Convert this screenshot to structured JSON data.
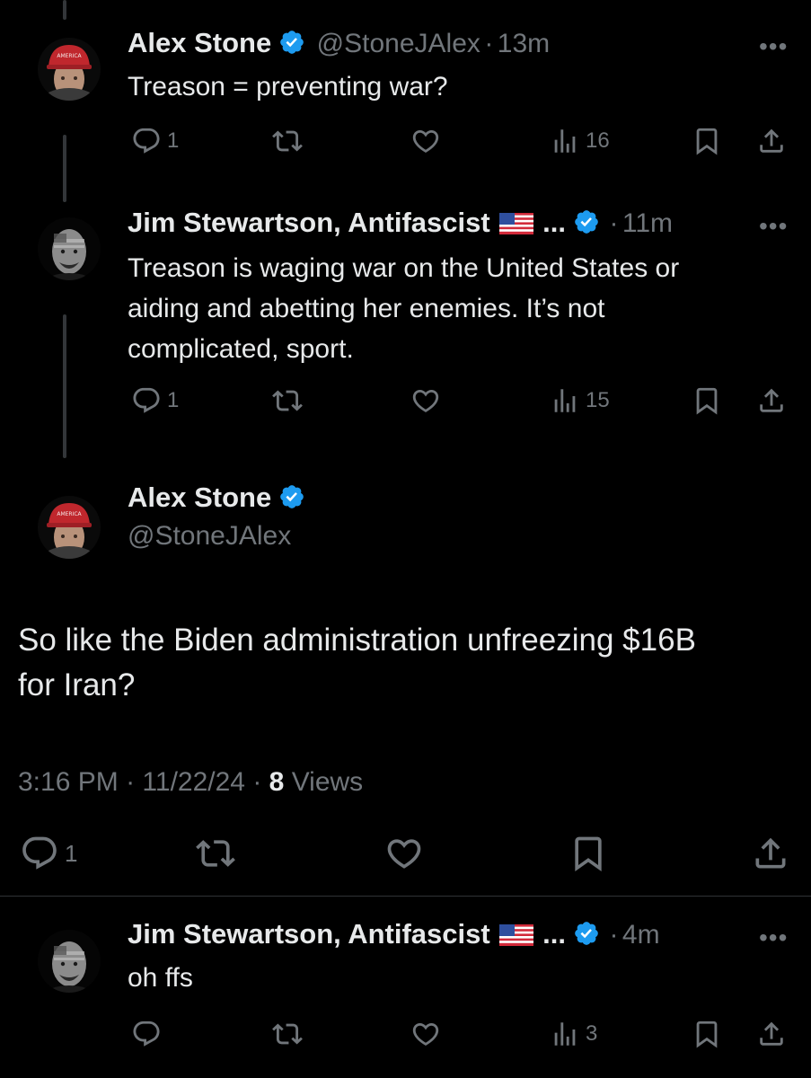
{
  "tweets": [
    {
      "name": "Alex Stone",
      "handle": "@StoneJAlex",
      "time": "13m",
      "text": "Treason = preventing war?",
      "replies": "1",
      "views": "16"
    },
    {
      "name": "Jim Stewartson, Antifascist",
      "ellipsis": "...",
      "time": "11m",
      "text_lines": [
        "Treason is waging war on the United States or",
        "aiding and abetting her enemies. It’s not",
        "complicated, sport."
      ],
      "replies": "1",
      "views": "15"
    }
  ],
  "main": {
    "name": "Alex Stone",
    "handle": "@StoneJAlex",
    "text_lines": [
      "So like the Biden administration unfreezing $16B",
      "for Iran?"
    ],
    "time": "3:16 PM",
    "date": "11/22/24",
    "views_count": "8",
    "views_label": "Views",
    "replies": "1"
  },
  "reply": {
    "name": "Jim Stewartson, Antifascist",
    "ellipsis": "...",
    "time": "4m",
    "text": "oh ffs",
    "views": "3"
  },
  "separator": "·",
  "more_label": "•••",
  "colors": {
    "verified": "#1d9bf0",
    "muted": "#71767b",
    "text": "#e7e9ea",
    "hat": "#c0272d"
  }
}
